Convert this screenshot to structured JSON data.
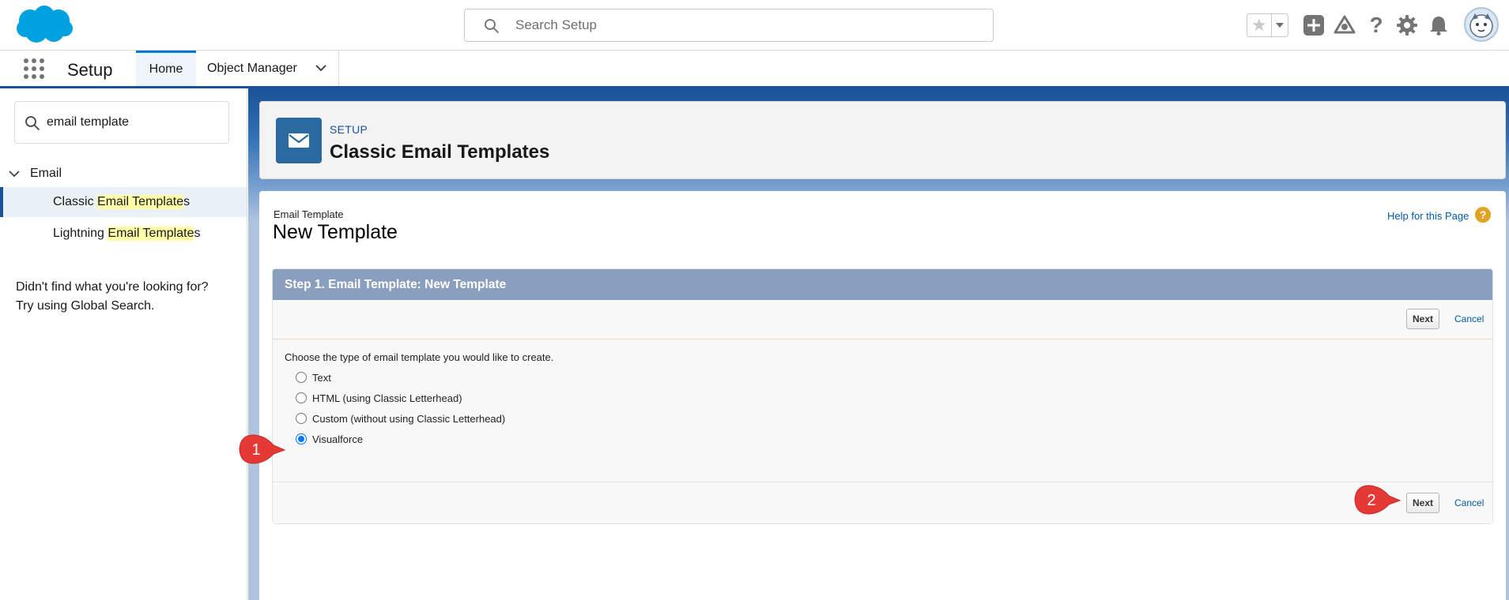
{
  "header": {
    "search_placeholder": "Search Setup"
  },
  "context_bar": {
    "app_name": "Setup",
    "tabs": [
      {
        "label": "Home"
      },
      {
        "label": "Object Manager"
      }
    ]
  },
  "sidebar": {
    "quickfind_value": "email template",
    "tree_parent": "Email",
    "items": [
      {
        "pre": "Classic ",
        "highlight": "Email Template",
        "post": "s",
        "selected": true
      },
      {
        "pre": "Lightning ",
        "highlight": "Email Template",
        "post": "s",
        "selected": false
      }
    ],
    "help_line1": "Didn't find what you're looking for?",
    "help_line2": "Try using Global Search."
  },
  "page_header": {
    "subtitle": "SETUP",
    "title": "Classic Email Templates",
    "icon": "email-icon"
  },
  "content": {
    "type_label": "Email Template",
    "title": "New Template",
    "help_link": "Help for this Page",
    "help_q": "?",
    "step_title": "Step 1. Email Template: New Template",
    "next_label": "Next",
    "cancel_label": "Cancel",
    "instruction": "Choose the type of email template you would like to create.",
    "options": [
      {
        "label": "Text",
        "checked": false
      },
      {
        "label": "HTML (using Classic Letterhead)",
        "checked": false
      },
      {
        "label": "Custom (without using Classic Letterhead)",
        "checked": false
      },
      {
        "label": "Visualforce",
        "checked": true
      }
    ]
  },
  "callouts": [
    {
      "number": "1"
    },
    {
      "number": "2"
    }
  ],
  "colors": {
    "brand_blue": "#1b5297",
    "step_header": "#8a9ebe",
    "callout_red": "#e53935",
    "link": "#015ba7"
  }
}
